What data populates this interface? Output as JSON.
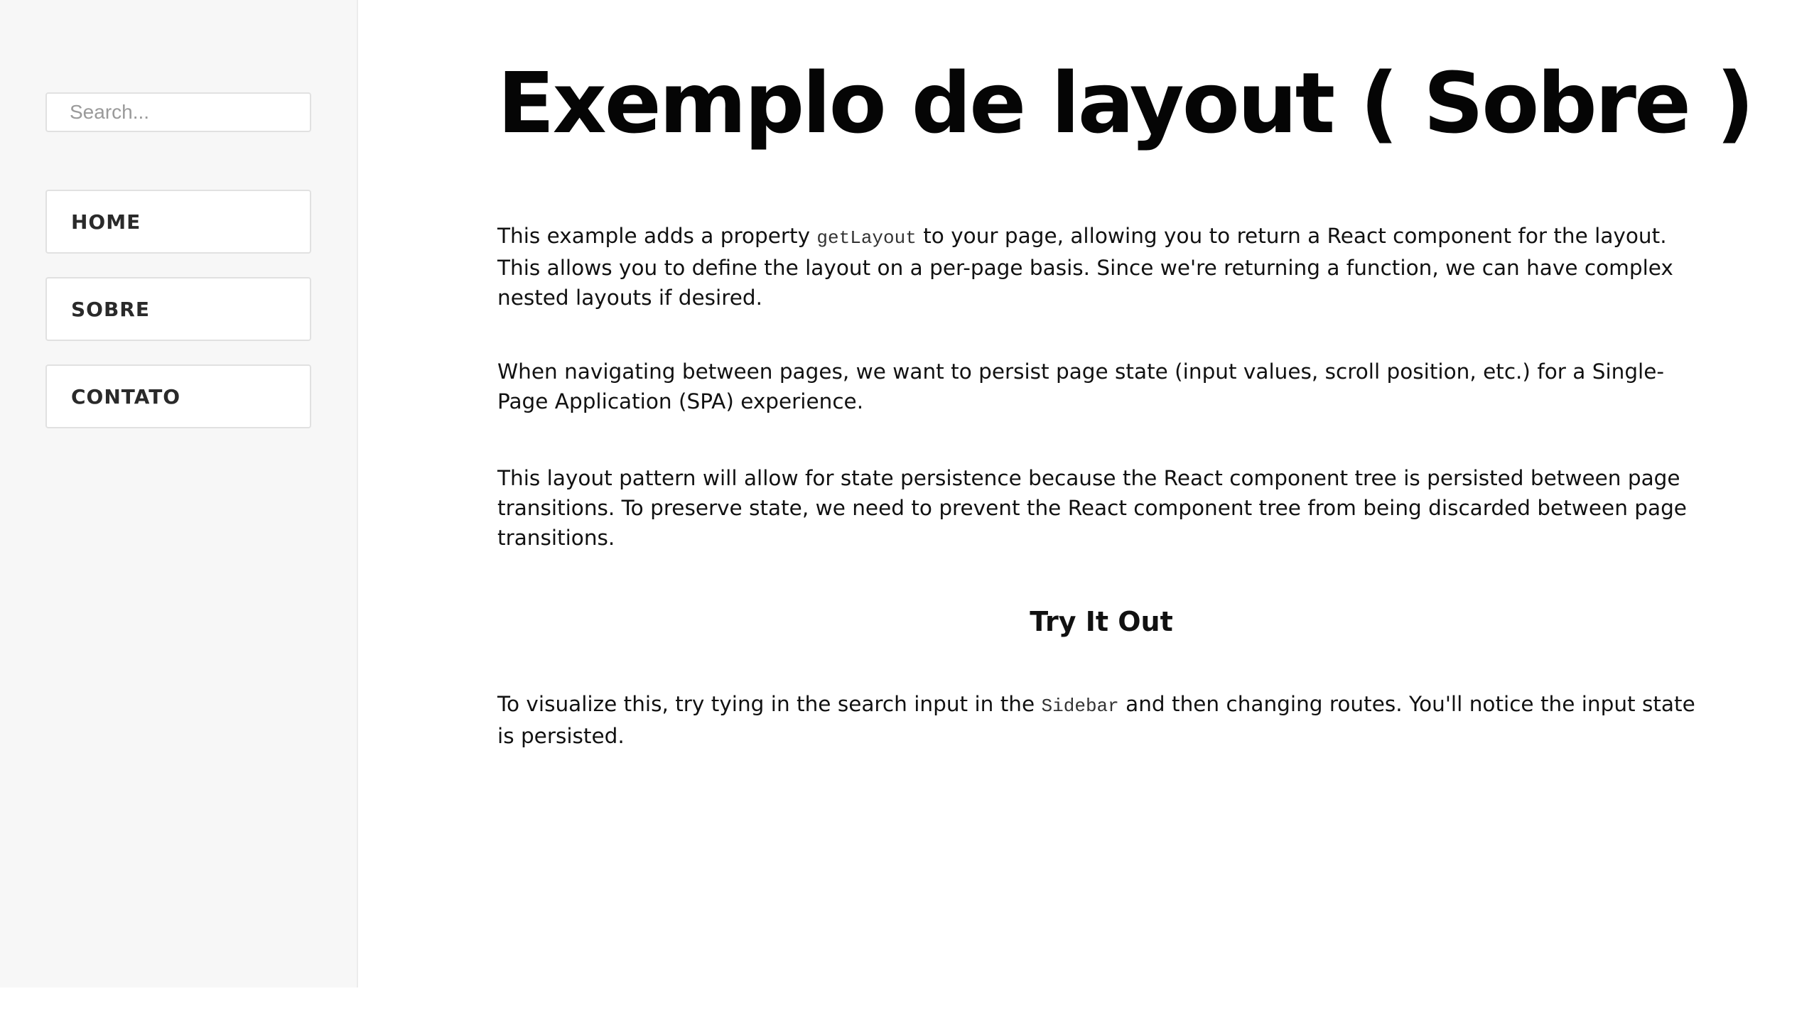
{
  "sidebar": {
    "search": {
      "placeholder": "Search...",
      "value": ""
    },
    "nav": [
      {
        "label": "HOME"
      },
      {
        "label": "SOBRE"
      },
      {
        "label": "CONTATO"
      }
    ]
  },
  "main": {
    "title": "Exemplo de layout ( Sobre )",
    "p1": {
      "before": "This example adds a property ",
      "code": "getLayout",
      "after": " to your page, allowing you to return a React component for the layout. This allows you to define the layout on a per-page basis. Since we're returning a function, we can have complex nested layouts if desired."
    },
    "p2": "When navigating between pages, we want to persist page state (input values, scroll position, etc.) for a Single-Page Application (SPA) experience.",
    "p3": "This layout pattern will allow for state persistence because the React component tree is persisted between page transitions. To preserve state, we need to prevent the React component tree from being discarded between page transitions.",
    "subheading": "Try It Out",
    "p4": {
      "before": "To visualize this, try tying in the search input in the ",
      "code": "Sidebar",
      "after": " and then changing routes. You'll notice the input state is persisted."
    }
  }
}
